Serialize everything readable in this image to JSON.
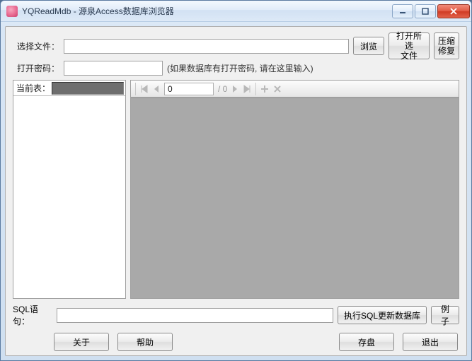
{
  "window": {
    "title": "YQReadMdb - 源泉Access数据库浏览器"
  },
  "top": {
    "select_file_label": "选择文件：",
    "browse": "浏览",
    "open_selected": "打开所选\n文件",
    "compact_repair": "压缩\n修复",
    "password_label": "打开密码：",
    "password_hint": "(如果数据库有打开密码, 请在这里输入)",
    "file_value": "",
    "password_value": ""
  },
  "mid": {
    "current_table_label": "当前表：",
    "record": {
      "pos": "0",
      "total": "/ 0"
    }
  },
  "sql": {
    "label": "SQL语句：",
    "value": "",
    "exec": "执行SQL更新数据库",
    "example": "例子"
  },
  "bottom": {
    "about": "关于",
    "help": "帮助",
    "save": "存盘",
    "exit": "退出"
  }
}
